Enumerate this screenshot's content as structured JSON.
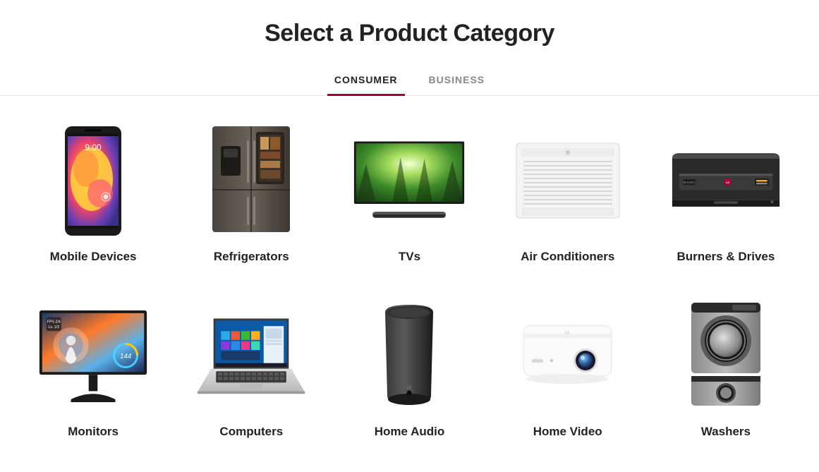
{
  "page": {
    "title": "Select a Product Category"
  },
  "tabs": [
    {
      "label": "Consumer",
      "active": true
    },
    {
      "label": "Business",
      "active": false
    }
  ],
  "categories": [
    {
      "name": "mobile-devices",
      "label": "Mobile Devices",
      "icon": "phone-icon"
    },
    {
      "name": "refrigerators",
      "label": "Refrigerators",
      "icon": "fridge-icon"
    },
    {
      "name": "tvs",
      "label": "TVs",
      "icon": "tv-icon"
    },
    {
      "name": "air-conditioners",
      "label": "Air Conditioners",
      "icon": "ac-icon"
    },
    {
      "name": "burners-drives",
      "label": "Burners & Drives",
      "icon": "drive-icon"
    },
    {
      "name": "monitors",
      "label": "Monitors",
      "icon": "monitor-icon"
    },
    {
      "name": "computers",
      "label": "Computers",
      "icon": "laptop-icon"
    },
    {
      "name": "home-audio",
      "label": "Home Audio",
      "icon": "speaker-icon"
    },
    {
      "name": "home-video",
      "label": "Home Video",
      "icon": "projector-icon"
    },
    {
      "name": "washers",
      "label": "Washers",
      "icon": "washer-icon"
    }
  ]
}
